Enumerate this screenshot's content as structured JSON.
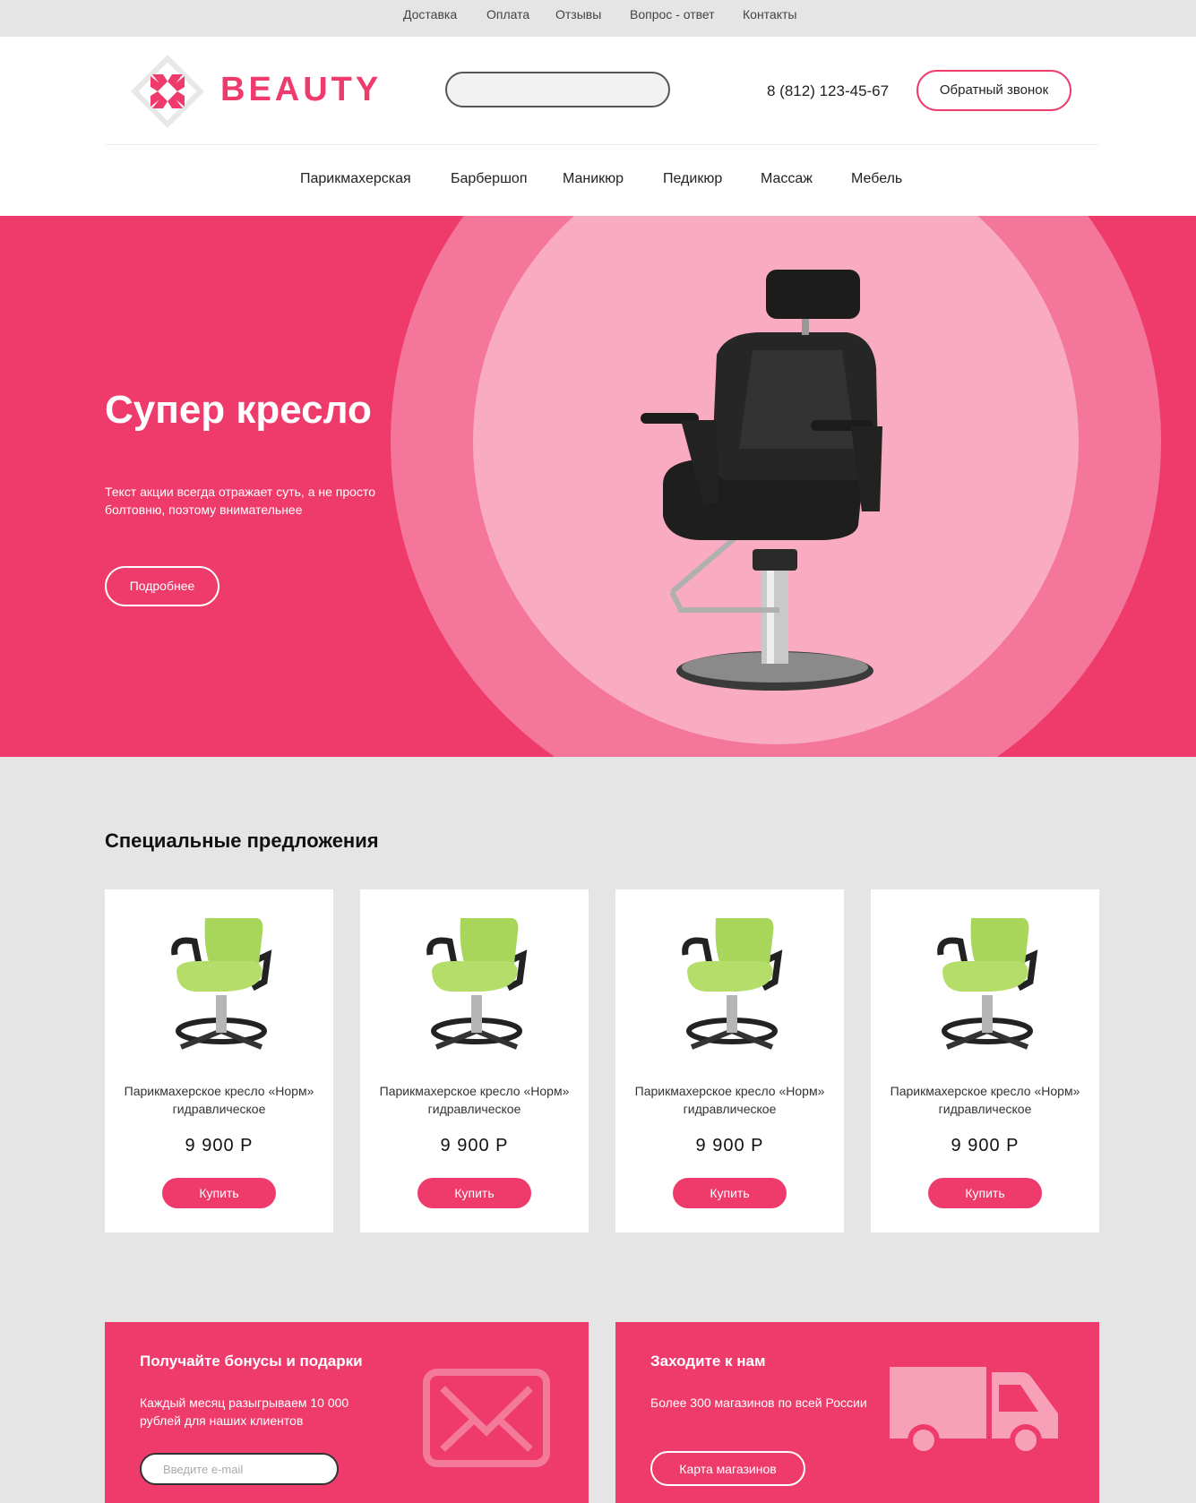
{
  "topnav": [
    "Доставка",
    "Оплата",
    "Отзывы",
    "Вопрос - ответ",
    "Контакты"
  ],
  "header": {
    "logo_text": "BEAUTY",
    "phone": "8 (812) 123-45-67",
    "callback_label": "Обратный звонок"
  },
  "nav": [
    "Парикмахерская",
    "Барбершоп",
    "Маникюр",
    "Педикюр",
    "Массаж",
    "Мебель"
  ],
  "hero": {
    "title": "Супер кресло",
    "text": "Текст акции всегда отражает суть, а не просто болтовню, поэтому внимательнее",
    "button": "Подробнее"
  },
  "offers": {
    "title": "Специальные предложения",
    "products": [
      {
        "name": "Парикмахерское кресло «Норм» гидравлическое",
        "price": "9 900 Р",
        "buy": "Купить"
      },
      {
        "name": "Парикмахерское кресло «Норм» гидравлическое",
        "price": "9 900 Р",
        "buy": "Купить"
      },
      {
        "name": "Парикмахерское кресло «Норм» гидравлическое",
        "price": "9 900 Р",
        "buy": "Купить"
      },
      {
        "name": "Парикмахерское кресло «Норм» гидравлическое",
        "price": "9 900 Р",
        "buy": "Купить"
      }
    ]
  },
  "promo_bonus": {
    "title": "Получайте бонусы и подарки",
    "text": "Каждый месяц разыгрываем 10 000 рублей для наших клиентов",
    "email_placeholder": "Введите e-mail",
    "icon": "envelope-icon"
  },
  "promo_stores": {
    "title": "Заходите к нам",
    "text": "Более 300 магазинов по всей России",
    "button": "Карта магазинов",
    "icon": "truck-icon"
  },
  "colors": {
    "accent": "#ef3b6c",
    "hero_ring": "#f4769a",
    "hero_inner": "#f8abc1",
    "product_green": "#a8d65a",
    "background": "#e5e5e5"
  }
}
